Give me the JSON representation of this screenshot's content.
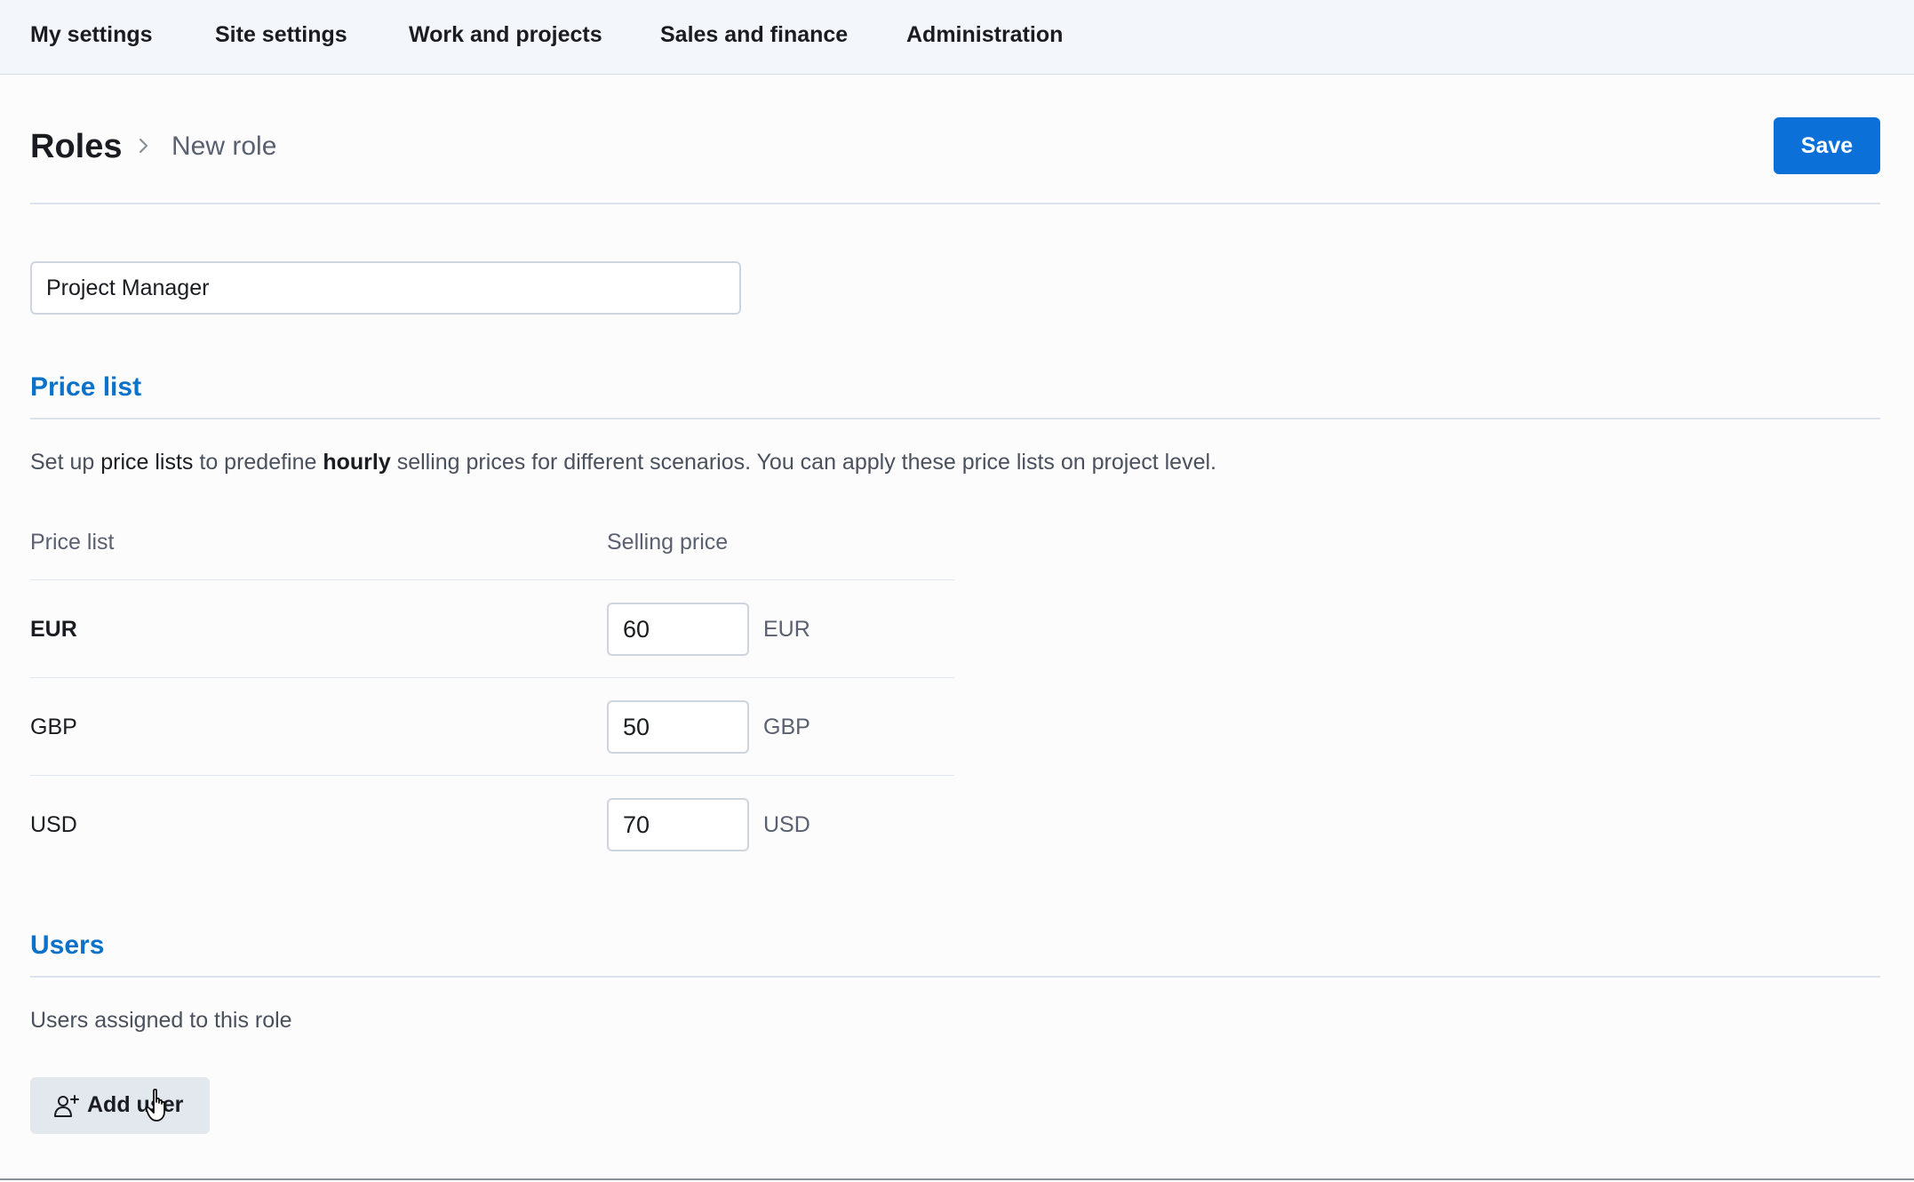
{
  "topnav": {
    "items": [
      "My settings",
      "Site settings",
      "Work and projects",
      "Sales and finance",
      "Administration"
    ]
  },
  "breadcrumb": {
    "root": "Roles",
    "current": "New role"
  },
  "toolbar": {
    "save_label": "Save"
  },
  "role_name": {
    "value": "Project Manager"
  },
  "price_list": {
    "title": "Price list",
    "description": {
      "part1": "Set up ",
      "link": "price lists",
      "part2": " to predefine ",
      "bold": "hourly",
      "part3": " selling prices for different scenarios. You can apply these price lists on project level."
    },
    "columns": [
      "Price list",
      "Selling price"
    ],
    "rows": [
      {
        "label": "EUR",
        "value": "60",
        "unit": "EUR"
      },
      {
        "label": "GBP",
        "value": "50",
        "unit": "GBP"
      },
      {
        "label": "USD",
        "value": "70",
        "unit": "USD"
      }
    ]
  },
  "users": {
    "title": "Users",
    "description": "Users assigned to this role",
    "add_label": "Add user"
  },
  "icons": {
    "separator": "chevron-right-icon",
    "add_user": "add-user-icon",
    "cursor": "hand-cursor-icon"
  },
  "colors": {
    "accent": "#0b71d9",
    "section_title": "#0b71c9",
    "nav_bg": "#f3f6fa"
  }
}
